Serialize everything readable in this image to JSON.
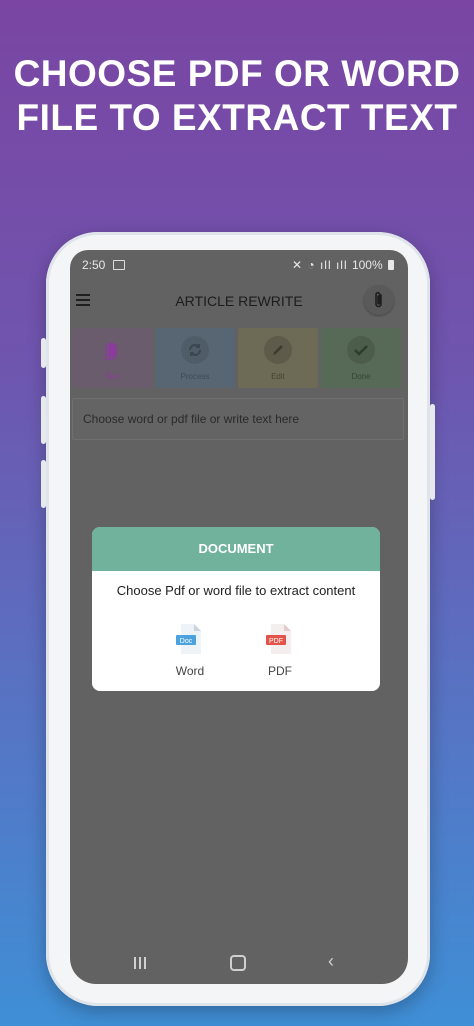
{
  "headline": {
    "line1": "CHOOSE PDF OR WORD",
    "line2": "FILE TO EXTRACT TEXT"
  },
  "status_bar": {
    "time": "2:50",
    "battery": "100%"
  },
  "app_bar": {
    "title": "ARTICLE REWRITE",
    "menu_icon": "hamburger-menu-icon",
    "attach_icon": "paperclip-icon"
  },
  "steps": [
    {
      "label": "Text",
      "icon": "document-icon",
      "color": "#8a3c9a"
    },
    {
      "label": "Process",
      "icon": "refresh-icon",
      "color": "#4d6278"
    },
    {
      "label": "Edit",
      "icon": "pencil-icon",
      "color": "#6b6340"
    },
    {
      "label": "Done",
      "icon": "check-icon",
      "color": "#3f6a41"
    }
  ],
  "input": {
    "placeholder": "Choose word or pdf file or write text here"
  },
  "dialog": {
    "header": "DOCUMENT",
    "message": "Choose Pdf or word file to extract content",
    "options": [
      {
        "label": "Word",
        "badge": "Doc",
        "color": "#4aa3df"
      },
      {
        "label": "PDF",
        "badge": "PDF",
        "color": "#e4534a"
      }
    ],
    "header_color": "#70b29b"
  }
}
